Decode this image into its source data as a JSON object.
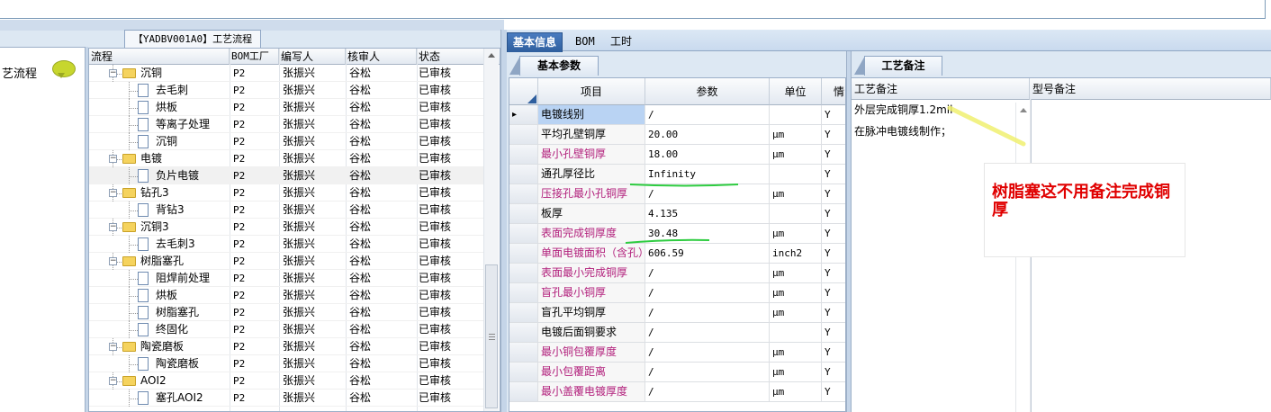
{
  "tree_tab": {
    "label": "【YADBV001A0】工艺流程"
  },
  "left_panel": {
    "label": "艺流程"
  },
  "tree": {
    "columns": [
      "流程",
      "BOM工厂",
      "编写人",
      "核审人",
      "状态"
    ],
    "rows": [
      {
        "name": "沉铜",
        "type": "folder",
        "level": 1,
        "factory": "P2",
        "writer": "张振兴",
        "reviewer": "谷松",
        "status": "已审核"
      },
      {
        "name": "去毛刺",
        "type": "doc",
        "level": 2,
        "factory": "P2",
        "writer": "张振兴",
        "reviewer": "谷松",
        "status": "已审核"
      },
      {
        "name": "烘板",
        "type": "doc",
        "level": 2,
        "factory": "P2",
        "writer": "张振兴",
        "reviewer": "谷松",
        "status": "已审核"
      },
      {
        "name": "等离子处理",
        "type": "doc",
        "level": 2,
        "factory": "P2",
        "writer": "张振兴",
        "reviewer": "谷松",
        "status": "已审核"
      },
      {
        "name": "沉铜",
        "type": "doc",
        "level": 2,
        "factory": "P2",
        "writer": "张振兴",
        "reviewer": "谷松",
        "status": "已审核"
      },
      {
        "name": "电镀",
        "type": "folder",
        "level": 1,
        "factory": "P2",
        "writer": "张振兴",
        "reviewer": "谷松",
        "status": "已审核"
      },
      {
        "name": "负片电镀",
        "type": "doc",
        "level": 2,
        "factory": "P2",
        "writer": "张振兴",
        "reviewer": "谷松",
        "status": "已审核",
        "selected": true
      },
      {
        "name": "钻孔3",
        "type": "folder",
        "level": 1,
        "factory": "P2",
        "writer": "张振兴",
        "reviewer": "谷松",
        "status": "已审核"
      },
      {
        "name": "背钻3",
        "type": "doc",
        "level": 2,
        "factory": "P2",
        "writer": "张振兴",
        "reviewer": "谷松",
        "status": "已审核"
      },
      {
        "name": "沉铜3",
        "type": "folder",
        "level": 1,
        "factory": "P2",
        "writer": "张振兴",
        "reviewer": "谷松",
        "status": "已审核"
      },
      {
        "name": "去毛刺3",
        "type": "doc",
        "level": 2,
        "factory": "P2",
        "writer": "张振兴",
        "reviewer": "谷松",
        "status": "已审核"
      },
      {
        "name": "树脂塞孔",
        "type": "folder",
        "level": 1,
        "factory": "P2",
        "writer": "张振兴",
        "reviewer": "谷松",
        "status": "已审核"
      },
      {
        "name": "阻焊前处理",
        "type": "doc",
        "level": 2,
        "factory": "P2",
        "writer": "张振兴",
        "reviewer": "谷松",
        "status": "已审核"
      },
      {
        "name": "烘板",
        "type": "doc",
        "level": 2,
        "factory": "P2",
        "writer": "张振兴",
        "reviewer": "谷松",
        "status": "已审核"
      },
      {
        "name": "树脂塞孔",
        "type": "doc",
        "level": 2,
        "factory": "P2",
        "writer": "张振兴",
        "reviewer": "谷松",
        "status": "已审核"
      },
      {
        "name": "终固化",
        "type": "doc",
        "level": 2,
        "factory": "P2",
        "writer": "张振兴",
        "reviewer": "谷松",
        "status": "已审核"
      },
      {
        "name": "陶瓷磨板",
        "type": "folder",
        "level": 1,
        "factory": "P2",
        "writer": "张振兴",
        "reviewer": "谷松",
        "status": "已审核"
      },
      {
        "name": "陶瓷磨板",
        "type": "doc",
        "level": 2,
        "factory": "P2",
        "writer": "张振兴",
        "reviewer": "谷松",
        "status": "已审核"
      },
      {
        "name": "AOI2",
        "type": "folder",
        "level": 1,
        "factory": "P2",
        "writer": "张振兴",
        "reviewer": "谷松",
        "status": "已审核"
      },
      {
        "name": "塞孔AOI2",
        "type": "doc",
        "level": 2,
        "factory": "P2",
        "writer": "张振兴",
        "reviewer": "谷松",
        "status": "已审核"
      }
    ]
  },
  "tabs": [
    "基本信息",
    "BOM",
    "工时"
  ],
  "basic_params": {
    "tab_label": "基本参数",
    "columns": [
      "项目",
      "参数",
      "单位"
    ],
    "truncated_column": "情",
    "rows": [
      {
        "item": "电镀线别",
        "value": "/",
        "unit": "",
        "flag": "Y",
        "required": false,
        "current": true
      },
      {
        "item": "平均孔壁铜厚",
        "value": "20.00",
        "unit": "μm",
        "flag": "Y",
        "required": false
      },
      {
        "item": "最小孔壁铜厚",
        "value": "18.00",
        "unit": "μm",
        "flag": "Y",
        "required": true
      },
      {
        "item": "通孔厚径比",
        "value": "Infinity",
        "unit": "",
        "flag": "Y",
        "required": false
      },
      {
        "item": "压接孔最小孔铜厚",
        "value": "/",
        "unit": "μm",
        "flag": "Y",
        "required": true
      },
      {
        "item": "板厚",
        "value": "4.135",
        "unit": "",
        "flag": "Y",
        "required": false
      },
      {
        "item": "表面完成铜厚度",
        "value": "30.48",
        "unit": "μm",
        "flag": "Y",
        "required": true
      },
      {
        "item": "单面电镀面积（含孔）",
        "value": "606.59",
        "unit": "inch2",
        "flag": "Y",
        "required": true
      },
      {
        "item": "表面最小完成铜厚",
        "value": "/",
        "unit": "μm",
        "flag": "Y",
        "required": true
      },
      {
        "item": "盲孔最小铜厚",
        "value": "/",
        "unit": "μm",
        "flag": "Y",
        "required": true
      },
      {
        "item": "盲孔平均铜厚",
        "value": "/",
        "unit": "μm",
        "flag": "Y",
        "required": false
      },
      {
        "item": "电镀后面铜要求",
        "value": "/",
        "unit": "",
        "flag": "Y",
        "required": false
      },
      {
        "item": "最小铜包覆厚度",
        "value": "/",
        "unit": "μm",
        "flag": "Y",
        "required": true
      },
      {
        "item": "最小包覆距离",
        "value": "/",
        "unit": "μm",
        "flag": "Y",
        "required": true
      },
      {
        "item": "最小盖覆电镀厚度",
        "value": "/",
        "unit": "μm",
        "flag": "Y",
        "required": true
      }
    ]
  },
  "process_notes": {
    "tab_label": "工艺备注",
    "columns": [
      "工艺备注",
      "型号备注"
    ],
    "lines": [
      "外层完成铜厚1.2mil",
      "在脉冲电镀线制作；"
    ]
  },
  "annotation": {
    "text": "树脂塞这不用备注完成铜厚"
  },
  "colors": {
    "required_item": "#b2207c",
    "annotation": "#e00000",
    "marker_green": "#2ecc40",
    "marker_yellow": "#f0f070"
  }
}
